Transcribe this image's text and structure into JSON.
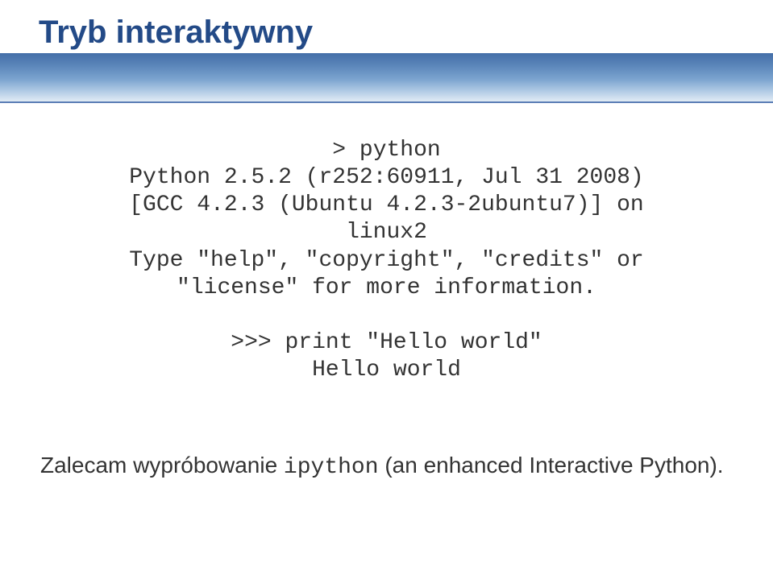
{
  "title": "Tryb interaktywny",
  "code": {
    "line1": "> python",
    "line2": "Python 2.5.2 (r252:60911, Jul 31 2008)",
    "line3": "[GCC 4.2.3 (Ubuntu 4.2.3-2ubuntu7)] on",
    "line4": "linux2",
    "line5": "Type \"help\", \"copyright\", \"credits\" or",
    "line6": "\"license\" for more information.",
    "line7": "",
    "line8": ">>> print \"Hello world\"",
    "line9": "Hello world"
  },
  "footer": {
    "pre": "Zalecam wypróbowanie ",
    "cmd": "ipython",
    "post": " (an enhanced Interactive Python)."
  }
}
